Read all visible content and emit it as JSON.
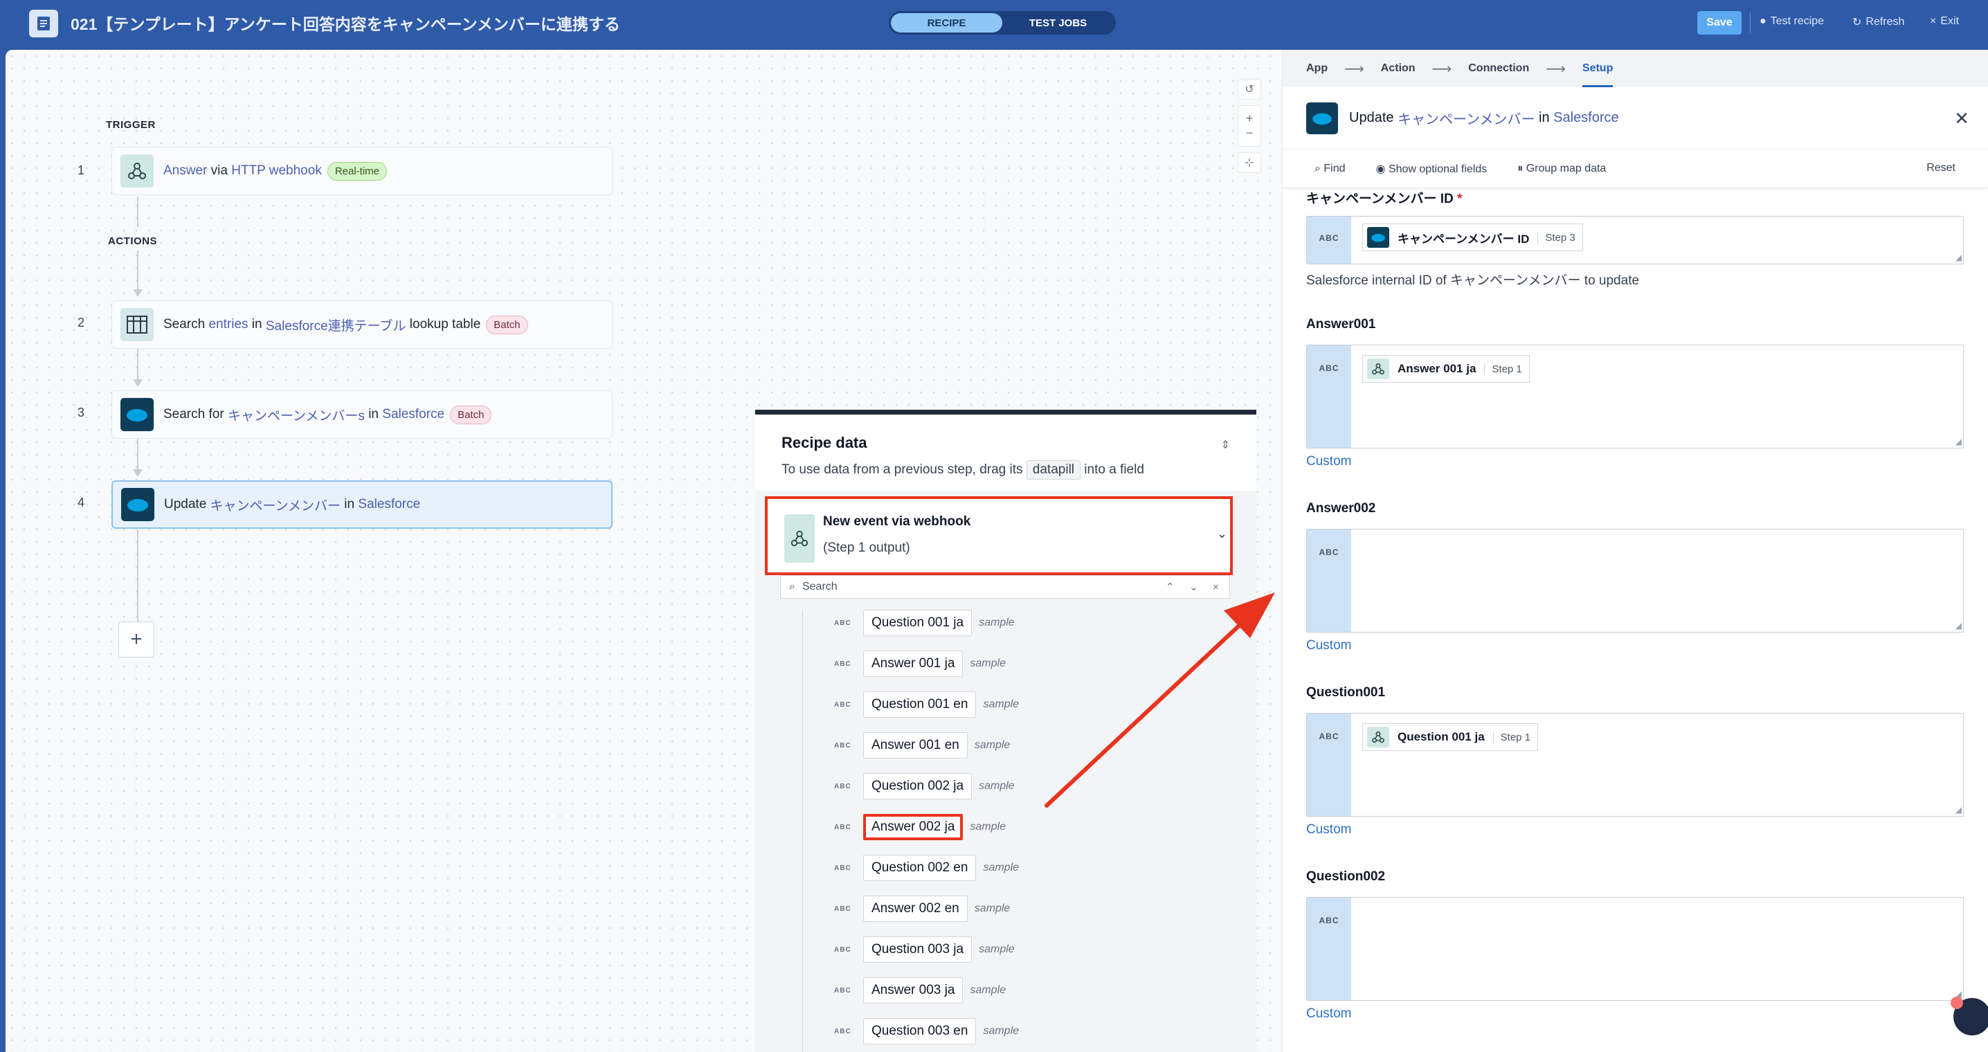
{
  "topbar": {
    "title": "021【テンプレート】アンケート回答内容をキャンペーンメンバーに連携する",
    "modes": [
      "RECIPE",
      "TEST JOBS"
    ],
    "save": "Save",
    "test_recipe": "Test recipe",
    "refresh": "Refresh",
    "exit": "Exit"
  },
  "canvas": {
    "trigger_label": "TRIGGER",
    "actions_label": "ACTIONS",
    "steps": [
      {
        "num": "1",
        "parts": [
          "Answer",
          " via ",
          "HTTP webhook"
        ],
        "badge": "Real-time"
      },
      {
        "num": "2",
        "parts": [
          "Search ",
          "entries",
          " in ",
          "Salesforce連携テーブル",
          " lookup table"
        ],
        "badge": "Batch"
      },
      {
        "num": "3",
        "parts": [
          "Search for ",
          "キャンペーンメンバーs",
          " in ",
          "Salesforce"
        ],
        "badge": "Batch"
      },
      {
        "num": "4",
        "parts": [
          "Update ",
          "キャンペーンメンバー",
          " in ",
          "Salesforce"
        ]
      }
    ],
    "add_symbol": "+"
  },
  "recipe_data": {
    "title": "Recipe data",
    "subtitle_pre": "To use data from a previous step, drag its",
    "subtitle_pill": "datapill",
    "subtitle_post": "into a field",
    "event_title": "New event via webhook",
    "event_sub": "(Step 1 output)",
    "search_placeholder": "Search",
    "abc": "ABC",
    "sample": "sample",
    "pills": [
      "Question 001 ja",
      "Answer 001 ja",
      "Question 001 en",
      "Answer 001 en",
      "Question 002 ja",
      "Answer 002 ja",
      "Question 002 en",
      "Answer 002 en",
      "Question 003 ja",
      "Answer 003 ja",
      "Question 003 en"
    ]
  },
  "right_panel": {
    "wizard": [
      "App",
      "Action",
      "Connection",
      "Setup"
    ],
    "header_pre": "Update ",
    "header_obj": "キャンペーンメンバー",
    "header_in": " in ",
    "header_app": "Salesforce",
    "tools": {
      "find": "Find",
      "optional": "Show optional fields",
      "group": "Group map data",
      "reset": "Reset"
    },
    "fields": [
      {
        "label": "キャンペーンメンバー ID",
        "required": "*",
        "pill": "キャンペーンメンバー ID",
        "step": "Step 3",
        "hint": "Salesforce internal ID of キャンペーンメンバー to update"
      },
      {
        "label": "Answer001",
        "pill": "Answer 001 ja",
        "step": "Step 1",
        "custom": "Custom"
      },
      {
        "label": "Answer002",
        "custom": "Custom"
      },
      {
        "label": "Question001",
        "pill": "Question 001 ja",
        "step": "Step 1",
        "custom": "Custom"
      },
      {
        "label": "Question002",
        "custom": "Custom"
      }
    ],
    "abc": "ABC"
  },
  "colors": {
    "accent": "#2f5aa8",
    "highlight": "#e8341f",
    "link": "#4c5fb1"
  }
}
